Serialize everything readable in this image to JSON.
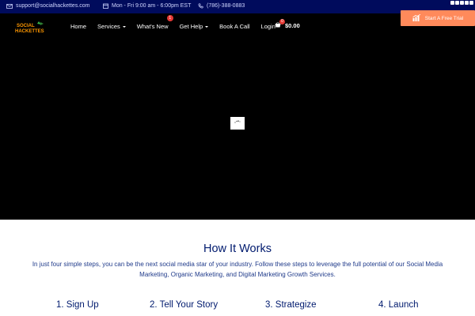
{
  "topbar": {
    "email": "support@socialhackettes.com",
    "hours": "Mon - Fri 9:00 am - 6:00pm EST",
    "phone": "(786)-388-0883"
  },
  "brand": {
    "logo_line1": "SOCIAL",
    "logo_line2": "HACKETTES"
  },
  "nav": {
    "home": "Home",
    "services": "Services",
    "whats_new": "What's New",
    "whats_new_badge": "1",
    "get_help": "Get Help",
    "book_call": "Book A Call",
    "login": "Login",
    "cart_count": "0",
    "cart_total": "$0.00"
  },
  "cta": {
    "label": "Start A Free Trial"
  },
  "how_it_works": {
    "title": "How It Works",
    "description": "In just four simple steps, you can be the next social media star of your industry. Follow these steps to leverage the full potential of our Social Media Marketing, Organic Marketing, and Digital Marketing Growth Services.",
    "steps": [
      "1. Sign Up",
      "2. Tell Your Story",
      "3. Strategize",
      "4. Launch"
    ]
  },
  "colors": {
    "topbar_bg": "#000b5c",
    "cta_bg": "#ff8a5b",
    "heading": "#001a6e",
    "badge": "#e53935"
  }
}
